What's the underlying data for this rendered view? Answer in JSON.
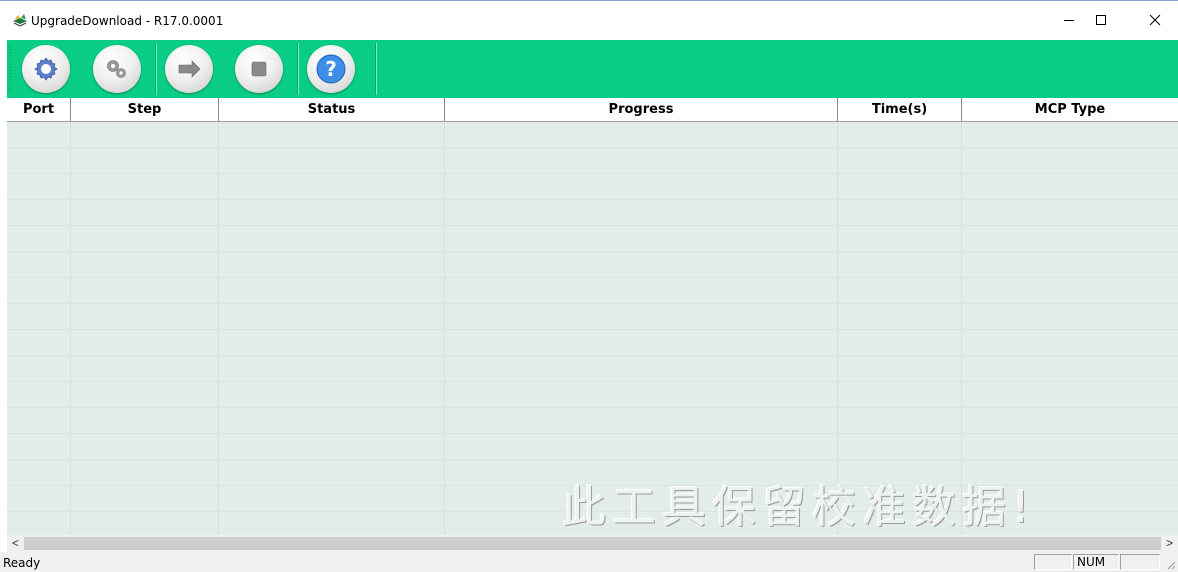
{
  "window": {
    "title": "UpgradeDownload - R17.0.0001",
    "minimize_glyph": "─",
    "maximize_glyph": "☐",
    "close_glyph": "✕"
  },
  "toolbar": {
    "background": "#0acd85",
    "buttons": [
      {
        "icon": "gear-icon"
      },
      {
        "icon": "gears-icon"
      },
      {
        "icon": "play-arrow-icon"
      },
      {
        "icon": "stop-icon"
      },
      {
        "icon": "help-icon",
        "glyph": "?"
      }
    ]
  },
  "grid": {
    "columns": [
      "Port",
      "Step",
      "Status",
      "Progress",
      "Time(s)",
      "MCP Type"
    ],
    "rows": [],
    "watermark": "此工具保留校准数据!"
  },
  "scrollbar": {
    "left_arrow": "<",
    "right_arrow": ">"
  },
  "statusbar": {
    "text": "Ready",
    "panes": [
      "",
      "NUM",
      ""
    ]
  }
}
